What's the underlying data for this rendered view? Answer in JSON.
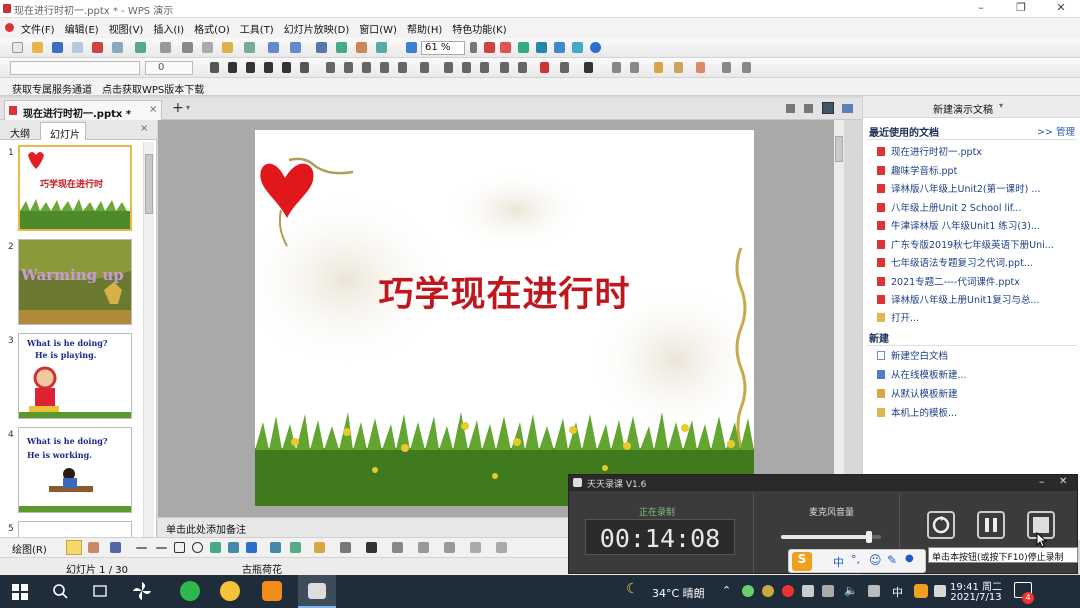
{
  "window": {
    "title": "现在进行时初一.pptx * - WPS 演示",
    "controls": [
      "–",
      "❐",
      "✕"
    ]
  },
  "menu": [
    "文件(F)",
    "编辑(E)",
    "视图(V)",
    "插入(I)",
    "格式(O)",
    "工具(T)",
    "幻灯片放映(D)",
    "窗口(W)",
    "帮助(H)",
    "特色功能(K)"
  ],
  "toolbar": {
    "zoom": "61 %",
    "font_size": "0"
  },
  "promo": {
    "item1": "获取专属服务通道",
    "item2": "点击获取WPS版本下载"
  },
  "tabs": {
    "doc_tab": "现在进行时初一.pptx *",
    "add": "+"
  },
  "left_panel": {
    "tab_outline": "大纲",
    "tab_slides": "幻灯片",
    "thumbs": [
      {
        "num": "1",
        "text": "巧学现在进行时"
      },
      {
        "num": "2",
        "text": "Warming up"
      },
      {
        "num": "3",
        "line1": "What is he doing?",
        "line2": "He is playing."
      },
      {
        "num": "4",
        "line1": "What is he doing?",
        "line2": "He is working."
      },
      {
        "num": "5"
      }
    ]
  },
  "slide": {
    "title": "巧学现在进行时",
    "title_color": "#c0161d"
  },
  "notes": {
    "placeholder": "单击此处添加备注"
  },
  "right_pane": {
    "header": "新建演示文稿",
    "recent_heading": "最近使用的文档",
    "manage": ">> 管理",
    "recent": [
      "现在进行时初一.pptx",
      "趣味学音标.ppt",
      "译林版八年级上Unit2(第一课时) ...",
      "八年级上册Unit 2 School lif...",
      "牛津译林版 八年级Unit1 练习(3)...",
      "广东专版2019秋七年级英语下册Uni...",
      "七年级语法专题复习之代词.ppt...",
      "2021专题二----代词课件.pptx",
      "译林版八年级上册Unit1复习与总..."
    ],
    "open": "打开...",
    "new_heading": "新建",
    "new_items": [
      "新建空白文档",
      "从在线模板新建...",
      "从默认模板新建",
      "本机上的模板..."
    ]
  },
  "drawbar": {
    "label": "绘图(R)"
  },
  "status": {
    "slide_pos": "幻灯片 1 / 30",
    "theme": "古瓶荷花"
  },
  "recorder": {
    "title": "天天录课 V1.6",
    "status": "正在录制",
    "timer": "00:14:08",
    "mic_label": "麦克风音量",
    "mic_level": 0.88,
    "tooltip": "单击本按钮(或按下F10)停止录制"
  },
  "ime": {
    "items": [
      "中",
      "°,",
      "☺",
      "✎",
      "🎤",
      "⌨"
    ]
  },
  "taskbar": {
    "weather": "34°C 晴朗",
    "tray_ime": "中",
    "time": "19:41 周二",
    "date": "2021/7/13",
    "badge": "4"
  },
  "colors": {
    "accent": "#3273c9",
    "slide_title": "#c0161d",
    "taskbar": "#1f2d3a"
  }
}
